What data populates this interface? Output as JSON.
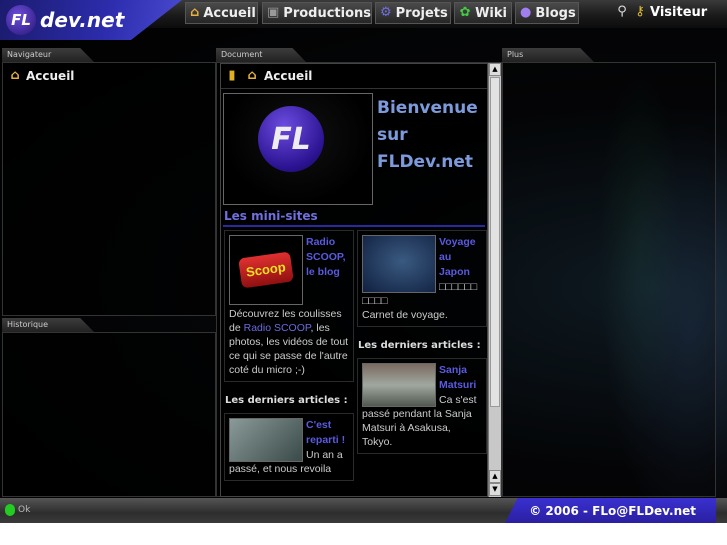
{
  "header": {
    "logo_text": "FL",
    "site_name": "dev.net",
    "nav": [
      {
        "label": "Accueil",
        "icon": "home-icon"
      },
      {
        "label": "Productions",
        "icon": "film-icon"
      },
      {
        "label": "Projets",
        "icon": "gears-icon"
      },
      {
        "label": "Wiki",
        "icon": "wiki-icon"
      },
      {
        "label": "Blogs",
        "icon": "blog-icon"
      }
    ],
    "user": "Visiteur"
  },
  "navigator": {
    "tab": "Navigateur",
    "items": [
      {
        "label": "Accueil"
      }
    ]
  },
  "history": {
    "tab": "Historique"
  },
  "document": {
    "tab": "Document",
    "breadcrumb": "Accueil",
    "logo_text": "FL",
    "title_lines": [
      "Bienvenue",
      "sur",
      "FLDev.net"
    ],
    "minisites_title": "Les mini-sites",
    "left": {
      "logo_text": "Scoop",
      "link": "Radio SCOOP, le blog",
      "desc_pre": "Découvrez les coulisses de ",
      "desc_link": "Radio SCOOP",
      "desc_post": ", les photos, les vidéos de tout ce qui se passe de l'autre coté du micro ;-)",
      "articles_title": "Les derniers articles :",
      "article_link": "C'est reparti !",
      "article_text": "Un an a passé, et nous revoila"
    },
    "right": {
      "link": "Voyage au Japon",
      "glyphs": "□□□□□□□□□□",
      "desc": "Carnet de voyage.",
      "articles_title": "Les derniers articles :",
      "article_link": "Sanja Matsuri",
      "article_text": "Ca s'est passé pendant la Sanja Matsuri à Asakusa, Tokyo."
    }
  },
  "more": {
    "tab": "Plus"
  },
  "status": {
    "text": "Ok"
  },
  "footer": {
    "copyright": "© 2006 - FLo@FLDev.net"
  }
}
